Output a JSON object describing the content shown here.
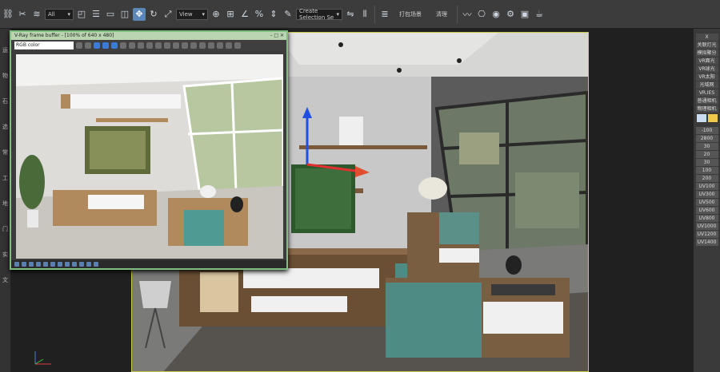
{
  "app": {
    "accent": "#5a86b8",
    "toolbar_filter_select": "All",
    "view_select": "View",
    "named_selection_select": "Create Selection Se",
    "toolbar_menu_items": [
      "打包场景",
      "清理"
    ]
  },
  "toolbar_icons": [
    "link-icon",
    "unlink-icon",
    "bind-space-warp-icon",
    "select-object-icon",
    "select-by-name-icon",
    "rect-selection-icon",
    "window-crossing-icon",
    "select-move-icon",
    "select-rotate-icon",
    "select-scale-icon",
    "reference-coord-icon",
    "pivot-icon",
    "snap-icon",
    "angle-snap-icon",
    "percent-snap-icon",
    "spinner-snap-icon",
    "edit-named-sel-icon",
    "mirror-icon",
    "align-icon",
    "layer-icon",
    "curve-editor-icon",
    "schematic-icon",
    "material-editor-icon",
    "render-setup-icon",
    "rendered-frame-icon",
    "render-icon"
  ],
  "left_strip_labels": [
    "运",
    "物",
    "石",
    "选",
    "常",
    "工",
    "地",
    "门",
    "实",
    "文"
  ],
  "vfb": {
    "title": "V-Ray frame buffer - [100% of 640 x 480]",
    "channel_select": "RGB color"
  },
  "right_panel": {
    "top_label": "X",
    "items": [
      "关联灯光",
      "模拟聚分",
      "VR面光",
      "VR球光",
      "VR太阳",
      "光域网",
      "VR.IES",
      "普通相机",
      "物理相机"
    ],
    "swatch_colors": [
      "#c9dcf0",
      "#f0c94a"
    ],
    "values": [
      "-100",
      "2800",
      "30",
      "20",
      "30",
      "100",
      "200",
      "UV100",
      "UV300",
      "UV500",
      "UV600",
      "UV800",
      "UV1000",
      "UV1200",
      "UV1400"
    ]
  }
}
